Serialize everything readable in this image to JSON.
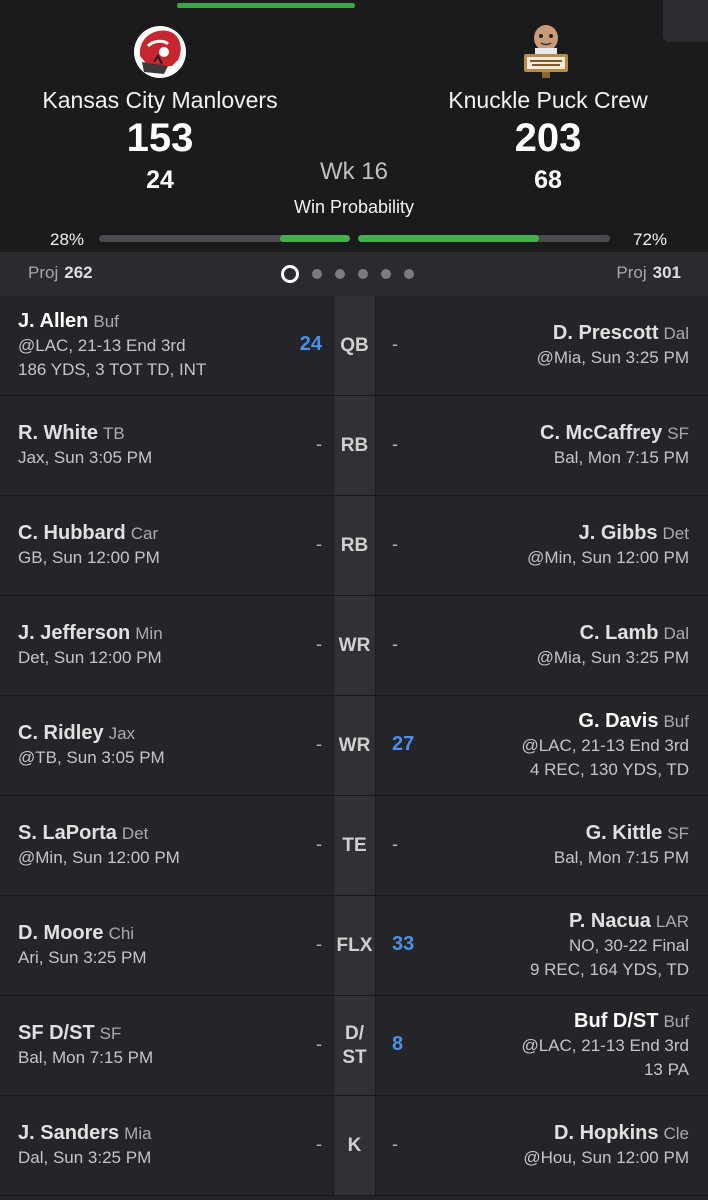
{
  "header": {
    "left_team": {
      "name": "Kansas City Manlovers",
      "score": "153",
      "live": "24",
      "win_pct": "28%",
      "win_fraction": 0.28,
      "proj_label": "Proj",
      "proj": "262",
      "logo_icon": "football-helmet-logo-icon"
    },
    "right_team": {
      "name": "Knuckle Puck Crew",
      "score": "203",
      "live": "68",
      "win_pct": "72%",
      "win_fraction": 0.72,
      "proj_label": "Proj",
      "proj": "301",
      "logo_icon": "cartoon-man-podium-logo-icon",
      "logo_sign": "YOU PLAY TO WIN THE GAME"
    },
    "week": "Wk 16",
    "win_probability_label": "Win Probability",
    "page_dots": {
      "count": 6,
      "active": 0
    }
  },
  "colors": {
    "accent_green": "#45b04c",
    "score_blue": "#4d8fe6",
    "background": "#242528",
    "header_bg": "#1a1b1d"
  },
  "rows": [
    {
      "pos": "QB",
      "pos2": "",
      "left": {
        "name": "J. Allen",
        "team": "Buf",
        "info": [
          "@LAC, 21-13 End 3rd",
          "186 YDS, 3 TOT TD, INT"
        ],
        "pts": "24",
        "bold": true
      },
      "right": {
        "name": "D. Prescott",
        "team": "Dal",
        "info": [
          "@Mia, Sun 3:25 PM"
        ],
        "pts": "-",
        "bold": false
      }
    },
    {
      "pos": "RB",
      "pos2": "",
      "left": {
        "name": "R. White",
        "team": "TB",
        "info": [
          "Jax, Sun 3:05 PM"
        ],
        "pts": "-",
        "bold": false
      },
      "right": {
        "name": "C. McCaffrey",
        "team": "SF",
        "info": [
          "Bal, Mon 7:15 PM"
        ],
        "pts": "-",
        "bold": false
      }
    },
    {
      "pos": "RB",
      "pos2": "",
      "left": {
        "name": "C. Hubbard",
        "team": "Car",
        "info": [
          "GB, Sun 12:00 PM"
        ],
        "pts": "-",
        "bold": false
      },
      "right": {
        "name": "J. Gibbs",
        "team": "Det",
        "info": [
          "@Min, Sun 12:00 PM"
        ],
        "pts": "-",
        "bold": false
      }
    },
    {
      "pos": "WR",
      "pos2": "",
      "left": {
        "name": "J. Jefferson",
        "team": "Min",
        "info": [
          "Det, Sun 12:00 PM"
        ],
        "pts": "-",
        "bold": false
      },
      "right": {
        "name": "C. Lamb",
        "team": "Dal",
        "info": [
          "@Mia, Sun 3:25 PM"
        ],
        "pts": "-",
        "bold": false
      }
    },
    {
      "pos": "WR",
      "pos2": "",
      "left": {
        "name": "C. Ridley",
        "team": "Jax",
        "info": [
          "@TB, Sun 3:05 PM"
        ],
        "pts": "-",
        "bold": false
      },
      "right": {
        "name": "G. Davis",
        "team": "Buf",
        "info": [
          "@LAC, 21-13 End 3rd",
          "4 REC, 130 YDS, TD"
        ],
        "pts": "27",
        "bold": true
      }
    },
    {
      "pos": "TE",
      "pos2": "",
      "left": {
        "name": "S. LaPorta",
        "team": "Det",
        "info": [
          "@Min, Sun 12:00 PM"
        ],
        "pts": "-",
        "bold": false
      },
      "right": {
        "name": "G. Kittle",
        "team": "SF",
        "info": [
          "Bal, Mon 7:15 PM"
        ],
        "pts": "-",
        "bold": false
      }
    },
    {
      "pos": "FLX",
      "pos2": "",
      "left": {
        "name": "D. Moore",
        "team": "Chi",
        "info": [
          "Ari, Sun 3:25 PM"
        ],
        "pts": "-",
        "bold": false
      },
      "right": {
        "name": "P. Nacua",
        "team": "LAR",
        "info": [
          "NO, 30-22 Final",
          "9 REC, 164 YDS, TD"
        ],
        "pts": "33",
        "bold": false
      }
    },
    {
      "pos": "D/",
      "pos2": "ST",
      "left": {
        "name": "SF D/ST",
        "team": "SF",
        "info": [
          "Bal, Mon 7:15 PM"
        ],
        "pts": "-",
        "bold": false
      },
      "right": {
        "name": "Buf D/ST",
        "team": "Buf",
        "info": [
          "@LAC, 21-13 End 3rd",
          "13 PA"
        ],
        "pts": "8",
        "bold": true
      }
    },
    {
      "pos": "K",
      "pos2": "",
      "left": {
        "name": "J. Sanders",
        "team": "Mia",
        "info": [
          "Dal, Sun 3:25 PM"
        ],
        "pts": "-",
        "bold": false
      },
      "right": {
        "name": "D. Hopkins",
        "team": "Cle",
        "info": [
          "@Hou, Sun 12:00 PM"
        ],
        "pts": "-",
        "bold": false
      }
    }
  ]
}
